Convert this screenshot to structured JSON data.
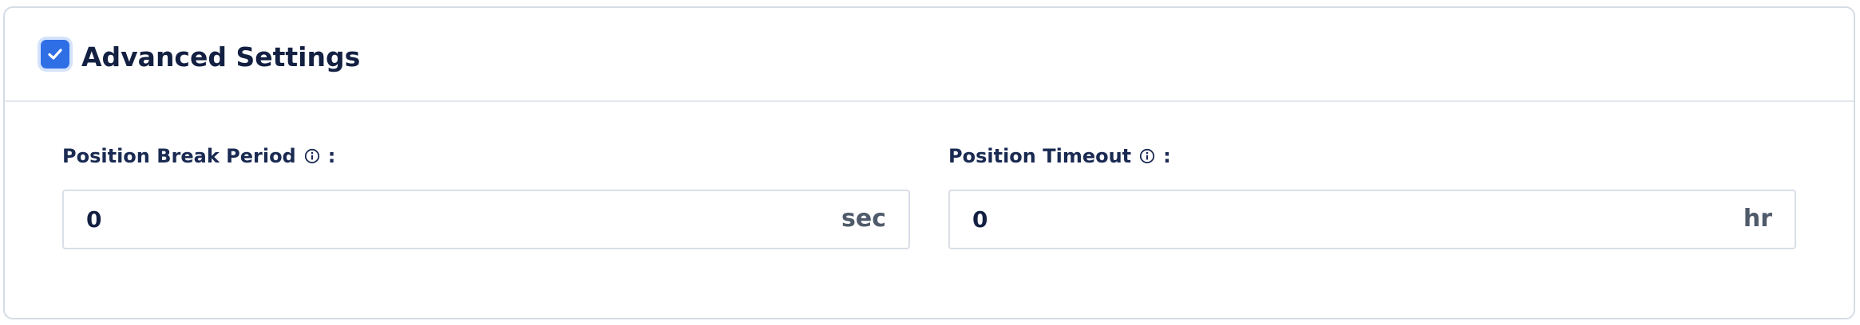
{
  "section": {
    "title": "Advanced Settings",
    "checked": true,
    "accent_color": "#2f6fe6"
  },
  "fields": {
    "break_period": {
      "label": "Position Break Period",
      "colon": ":",
      "info_icon": "info-circle-icon",
      "value": "0",
      "unit": "sec"
    },
    "timeout": {
      "label": "Position Timeout",
      "colon": ":",
      "info_icon": "info-circle-icon",
      "value": "0",
      "unit": "hr"
    }
  }
}
